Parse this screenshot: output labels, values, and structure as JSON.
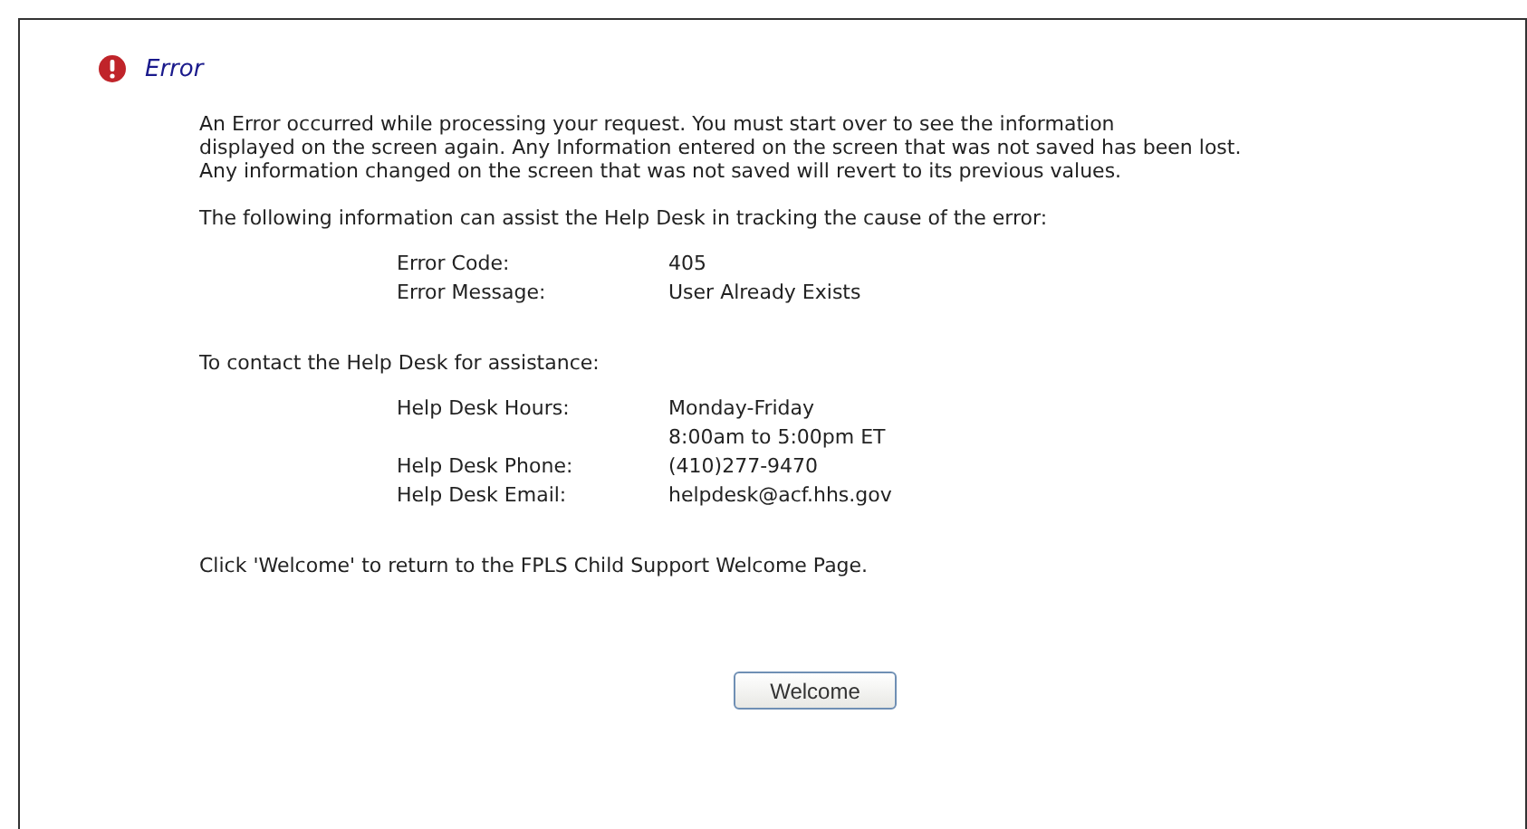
{
  "title": "Error",
  "message_lines": [
    "An Error occurred while processing your request. You must start over to see the information",
    "displayed on the screen again. Any Information entered on the screen that was not saved has been lost.",
    "Any information changed on the screen that was not saved will revert to its previous values."
  ],
  "error_intro": "The following information can assist the Help Desk in tracking the cause of the error:",
  "error_details": [
    {
      "label": "Error Code:",
      "values": [
        "405"
      ]
    },
    {
      "label": "Error Message:",
      "values": [
        "User Already Exists"
      ]
    }
  ],
  "contact_intro": "To contact the Help Desk for assistance:",
  "contact_details": [
    {
      "label": "Help Desk Hours:",
      "values": [
        "Monday-Friday",
        "8:00am to 5:00pm ET"
      ]
    },
    {
      "label": "Help Desk Phone:",
      "values": [
        "(410)277-9470"
      ]
    },
    {
      "label": "Help Desk Email:",
      "values": [
        "helpdesk@acf.hhs.gov"
      ]
    }
  ],
  "return_note": "Click 'Welcome' to return to the FPLS Child Support Welcome Page.",
  "button": "Welcome"
}
